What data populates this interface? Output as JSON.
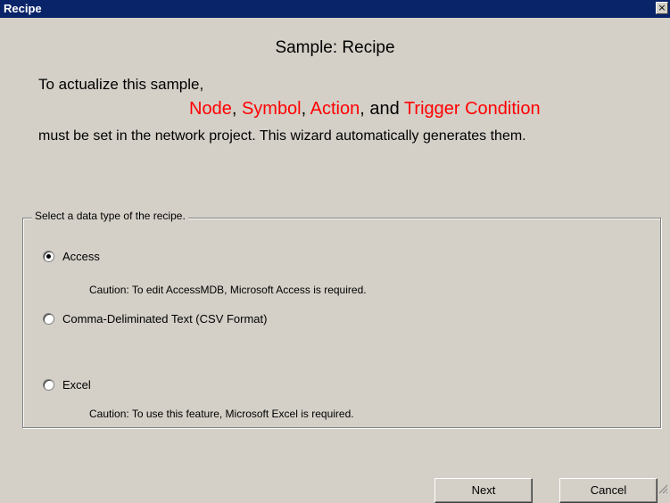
{
  "window": {
    "title": "Recipe",
    "close_glyph": "×"
  },
  "heading": "Sample: Recipe",
  "intro": {
    "line1": "To actualize this sample,",
    "node": "Node",
    "sep1": ", ",
    "symbol": "Symbol",
    "sep2": ", ",
    "action": "Action",
    "sep3": ", and ",
    "trigger": "Trigger Condition",
    "line3": "must be set in the network project. This wizard automatically generates them."
  },
  "group": {
    "legend": "Select a data type of the recipe.",
    "options": [
      {
        "label": "Access",
        "selected": true
      },
      {
        "label": "Comma-Deliminated Text (CSV Format)",
        "selected": false
      },
      {
        "label": "Excel",
        "selected": false
      }
    ],
    "caution_access": "Caution: To edit AccessMDB, Microsoft Access is required.",
    "caution_excel": "Caution: To use this feature, Microsoft Excel is required."
  },
  "buttons": {
    "next": "Next",
    "cancel": "Cancel"
  },
  "colors": {
    "titlebar": "#0a246a",
    "highlight": "#ff0000",
    "face": "#d4d0c8"
  },
  "icons": {
    "close": "close-icon",
    "resize": "resize-grip-icon"
  }
}
